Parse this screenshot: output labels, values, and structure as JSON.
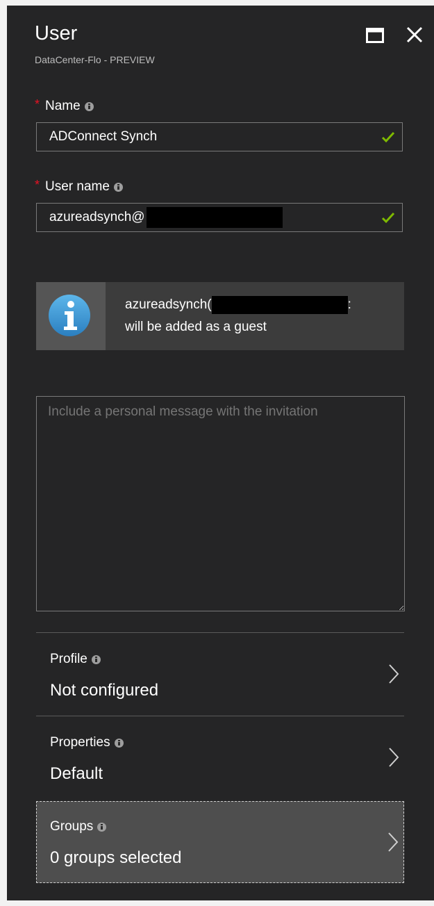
{
  "header": {
    "title": "User",
    "subtitle": "DataCenter-Flo - PREVIEW",
    "maximize_icon": "maximize-icon",
    "close_icon": "close-icon"
  },
  "form": {
    "name": {
      "label": "Name",
      "required": true,
      "value": "ADConnect Synch",
      "valid": true
    },
    "username": {
      "label": "User name",
      "required": true,
      "value": "azureadsynch@",
      "valid": true
    }
  },
  "info_banner": {
    "icon": "info-circle-icon",
    "line1": "azureadsynch(",
    "line1_suffix": ":",
    "line2": "will be added as a guest"
  },
  "message": {
    "placeholder": "Include a personal message with the invitation"
  },
  "nav": [
    {
      "label": "Profile",
      "value": "Not configured"
    },
    {
      "label": "Properties",
      "value": "Default"
    },
    {
      "label": "Groups",
      "value": "0 groups selected",
      "selected": true
    }
  ],
  "colors": {
    "background": "#252526",
    "required_star": "#e81123",
    "check": "#7fba00",
    "info_icon": "#3a9ad9",
    "selected_row": "#4e4e4e"
  }
}
